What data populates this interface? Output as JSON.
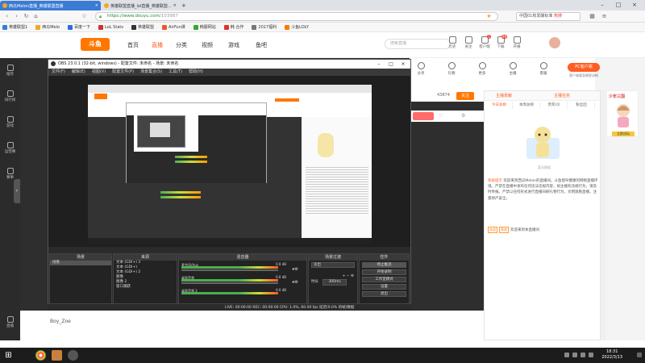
{
  "browser": {
    "tabs": [
      {
        "label": "西瓜Melon直播_英雄联盟直播",
        "active": true
      },
      {
        "label": "英雄联盟直播_lol直播_英雄联盟...",
        "active": false
      }
    ],
    "new_tab": "+",
    "url_host": "https://www.douyu.com",
    "url_path": "/103987",
    "search_placeholder": "中国01枚发酵标准",
    "search_hot": "热搜",
    "bookmarks": [
      "英雄联盟1",
      "西瓜Melo",
      "百度一下",
      "LoL Stats",
      "英雄联盟",
      "AirFun课",
      "韩服网站",
      "韩 合作",
      "2017福利",
      "斗鱼LOLY"
    ]
  },
  "douyu": {
    "logo": "斗鱼",
    "nav": [
      "首页",
      "直播",
      "分类",
      "视频",
      "游戏",
      "鱼吧"
    ],
    "nav_active": "直播",
    "search_placeholder": "搜索直播",
    "header_icons": [
      {
        "name": "history",
        "label": "历史",
        "badge": ""
      },
      {
        "name": "follow",
        "label": "关注",
        "badge": ""
      },
      {
        "name": "message",
        "label": "客户端",
        "badge": "1"
      },
      {
        "name": "task",
        "label": "下载",
        "badge": "99"
      },
      {
        "name": "start",
        "label": "开播",
        "badge": ""
      }
    ]
  },
  "sidebar": {
    "items": [
      "推荐",
      "排行榜",
      "游戏",
      "运营赛",
      "赛事",
      "直播"
    ],
    "toggle": "›"
  },
  "room": {
    "top_icons": [
      "分享",
      "礼物",
      "更多",
      "主播",
      "客服"
    ],
    "pc_button": "PC客户端",
    "pc_sub": "客户端看直播更流畅",
    "follow_count": "43874",
    "follow_button": "关注"
  },
  "chat": {
    "rank_tabs": [
      "主播贡献",
      "主播任务"
    ],
    "sub_tabs": [
      "今日总榜",
      "本周总榜",
      "贵宾(0)",
      "粉丝团"
    ],
    "image_caption": "暂无数据",
    "system_tag": "系统提示",
    "system_text": "欢迎来到西瓜Melon的直播间。斗鱼倡导健康的网络直播环境。严禁在直播中发布任何违法违规内容，如主播有违规行为，请及时举报。严禁以任何形式进行直播间刷礼物行为，文明观看直播，注意财产安全。",
    "welcome_tag1": "欢迎",
    "welcome_tag2": "贵宾",
    "welcome_text": "欢迎来到本直播间"
  },
  "ad": {
    "title": "少年三国",
    "button": "立即试玩"
  },
  "obs": {
    "title": "OBS 23.0.1 (32-bit, windows) - 配置文件: 未命名 - 场景: 未命名",
    "menu": [
      "文件(F)",
      "编辑(E)",
      "视图(V)",
      "配置文件(P)",
      "场景集合(S)",
      "工具(T)",
      "帮助(H)"
    ],
    "docks": {
      "scenes": {
        "title": "场景",
        "items": [
          "场景"
        ]
      },
      "sources": {
        "title": "来源",
        "items": [
          "文本 (GDI+) 3",
          "文本 (GDI+)",
          "文本 (GDI+) 2",
          "图像",
          "图像 2",
          "窗口捕获"
        ]
      },
      "mixer": {
        "title": "混音器",
        "channels": [
          {
            "label": "麦克风/Aux",
            "db": "0.0 dB"
          },
          {
            "label": "桌面音频",
            "db": "0.0 dB"
          },
          {
            "label": "桌面音频 2",
            "db": "0.0 dB"
          }
        ]
      },
      "transitions": {
        "title": "场景过渡",
        "type": "淡出",
        "duration_label": "时长",
        "duration": "300ms"
      },
      "controls": {
        "title": "控件",
        "buttons": [
          "停止推流",
          "开始录制",
          "工作室模式",
          "设置",
          "退出"
        ]
      }
    },
    "status": "LIVE: 00:00:00   REC: 00:00:00   CPU: 1.0%, 60.00 fps   延迟(0.0% 的帧)数据"
  },
  "below": {
    "user": "Boy_Zoe"
  },
  "taskbar": {
    "time": "18:31",
    "date": "2022/3/13"
  },
  "colors": {
    "brand": "#ff7700",
    "accent": "#ff5d23",
    "tab_active": "#3a7bd5"
  }
}
